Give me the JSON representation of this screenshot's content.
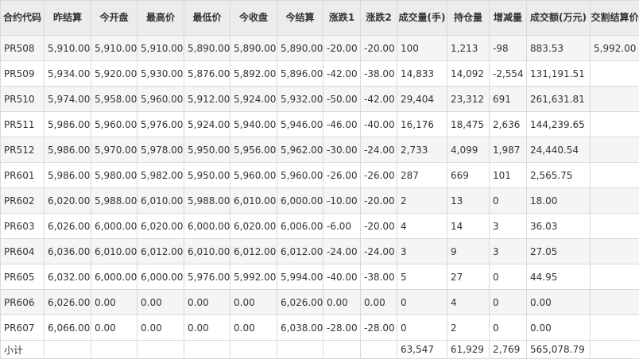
{
  "headers": [
    "合约代码",
    "昨结算",
    "今开盘",
    "最高价",
    "最低价",
    "今收盘",
    "今结算",
    "涨跌1",
    "涨跌2",
    "成交量(手)",
    "持仓量",
    "增减量",
    "成交额(万元)",
    "交割结算价"
  ],
  "rows": [
    [
      "PR508",
      "5,910.00",
      "5,910.00",
      "5,910.00",
      "5,890.00",
      "5,890.00",
      "5,890.00",
      "-20.00",
      "-20.00",
      "100",
      "1,213",
      "-98",
      "883.53",
      "5,992.00"
    ],
    [
      "PR509",
      "5,934.00",
      "5,920.00",
      "5,930.00",
      "5,876.00",
      "5,892.00",
      "5,896.00",
      "-42.00",
      "-38.00",
      "14,833",
      "14,092",
      "-2,554",
      "131,191.51",
      ""
    ],
    [
      "PR510",
      "5,974.00",
      "5,958.00",
      "5,960.00",
      "5,912.00",
      "5,924.00",
      "5,932.00",
      "-50.00",
      "-42.00",
      "29,404",
      "23,312",
      "691",
      "261,631.81",
      ""
    ],
    [
      "PR511",
      "5,986.00",
      "5,960.00",
      "5,976.00",
      "5,924.00",
      "5,940.00",
      "5,946.00",
      "-46.00",
      "-40.00",
      "16,176",
      "18,475",
      "2,636",
      "144,239.65",
      ""
    ],
    [
      "PR512",
      "5,986.00",
      "5,970.00",
      "5,978.00",
      "5,950.00",
      "5,956.00",
      "5,962.00",
      "-30.00",
      "-24.00",
      "2,733",
      "4,099",
      "1,987",
      "24,440.54",
      ""
    ],
    [
      "PR601",
      "5,986.00",
      "5,980.00",
      "5,982.00",
      "5,950.00",
      "5,960.00",
      "5,960.00",
      "-26.00",
      "-26.00",
      "287",
      "669",
      "101",
      "2,565.75",
      ""
    ],
    [
      "PR602",
      "6,020.00",
      "5,988.00",
      "6,010.00",
      "5,988.00",
      "6,010.00",
      "6,000.00",
      "-10.00",
      "-20.00",
      "2",
      "13",
      "0",
      "18.00",
      ""
    ],
    [
      "PR603",
      "6,026.00",
      "6,000.00",
      "6,020.00",
      "6,000.00",
      "6,020.00",
      "6,006.00",
      "-6.00",
      "-20.00",
      "4",
      "14",
      "3",
      "36.03",
      ""
    ],
    [
      "PR604",
      "6,036.00",
      "6,010.00",
      "6,012.00",
      "6,010.00",
      "6,012.00",
      "6,012.00",
      "-24.00",
      "-24.00",
      "3",
      "9",
      "3",
      "27.05",
      ""
    ],
    [
      "PR605",
      "6,032.00",
      "6,000.00",
      "6,000.00",
      "5,976.00",
      "5,992.00",
      "5,994.00",
      "-40.00",
      "-38.00",
      "5",
      "27",
      "0",
      "44.95",
      ""
    ],
    [
      "PR606",
      "6,026.00",
      "0.00",
      "0.00",
      "0.00",
      "0.00",
      "6,026.00",
      "0.00",
      "0.00",
      "0",
      "4",
      "0",
      "0.00",
      ""
    ],
    [
      "PR607",
      "6,066.00",
      "0.00",
      "0.00",
      "0.00",
      "0.00",
      "6,038.00",
      "-28.00",
      "-28.00",
      "0",
      "2",
      "0",
      "0.00",
      ""
    ]
  ],
  "summary": [
    "小计",
    "",
    "",
    "",
    "",
    "",
    "",
    "",
    "",
    "63,547",
    "61,929",
    "2,769",
    "565,078.79",
    ""
  ]
}
